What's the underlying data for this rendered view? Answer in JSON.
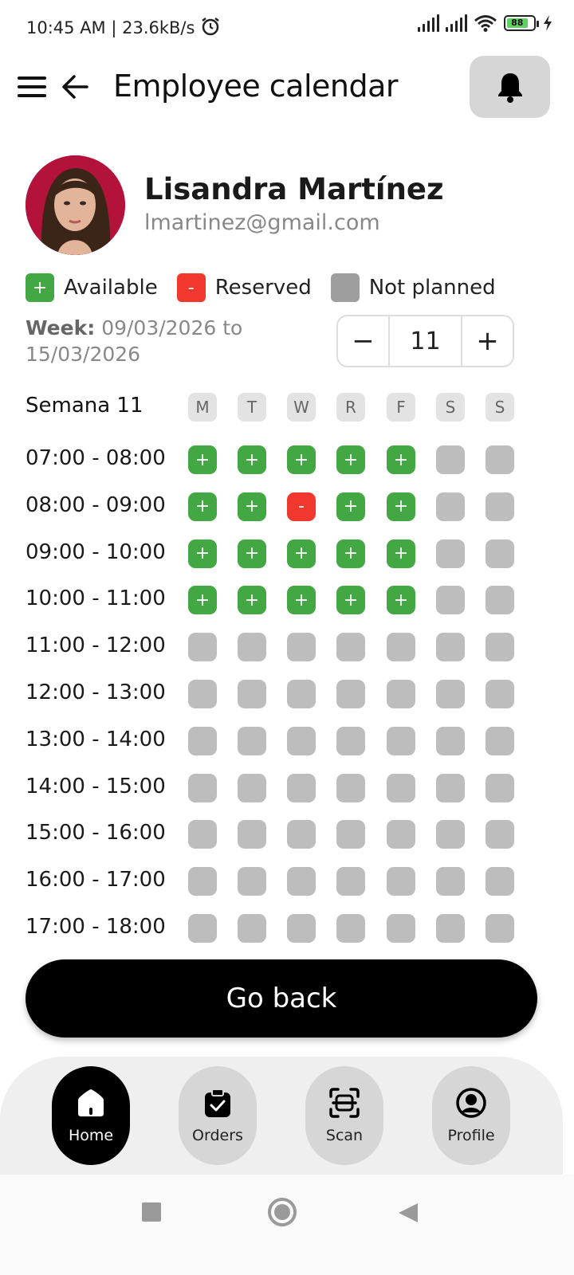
{
  "status_bar": {
    "time": "10:45 AM | 23.6kB/s",
    "battery": "88"
  },
  "header": {
    "title": "Employee calendar"
  },
  "profile": {
    "name": "Lisandra Martínez",
    "email": "lmartinez@gmail.com"
  },
  "legend": [
    {
      "label": "Available",
      "symbol": "+",
      "color": "#43a843"
    },
    {
      "label": "Reserved",
      "symbol": "-",
      "color": "#f0382e"
    },
    {
      "label": "Not planned",
      "symbol": "",
      "color": "#9e9e9e"
    }
  ],
  "week": {
    "label": "Week:",
    "range": "09/03/2026 to 15/03/2026",
    "number": "11"
  },
  "stepper": {
    "minus": "−",
    "plus": "+"
  },
  "calendar": {
    "title": "Semana 11",
    "days": [
      "M",
      "T",
      "W",
      "R",
      "F",
      "S",
      "S"
    ],
    "slots": [
      {
        "time": "07:00 - 08:00",
        "states": [
          "available",
          "available",
          "available",
          "available",
          "available",
          "not_planned",
          "not_planned"
        ]
      },
      {
        "time": "08:00 - 09:00",
        "states": [
          "available",
          "available",
          "reserved",
          "available",
          "available",
          "not_planned",
          "not_planned"
        ]
      },
      {
        "time": "09:00 - 10:00",
        "states": [
          "available",
          "available",
          "available",
          "available",
          "available",
          "not_planned",
          "not_planned"
        ]
      },
      {
        "time": "10:00 - 11:00",
        "states": [
          "available",
          "available",
          "available",
          "available",
          "available",
          "not_planned",
          "not_planned"
        ]
      },
      {
        "time": "11:00 - 12:00",
        "states": [
          "not_planned",
          "not_planned",
          "not_planned",
          "not_planned",
          "not_planned",
          "not_planned",
          "not_planned"
        ]
      },
      {
        "time": "12:00 - 13:00",
        "states": [
          "not_planned",
          "not_planned",
          "not_planned",
          "not_planned",
          "not_planned",
          "not_planned",
          "not_planned"
        ]
      },
      {
        "time": "13:00 - 14:00",
        "states": [
          "not_planned",
          "not_planned",
          "not_planned",
          "not_planned",
          "not_planned",
          "not_planned",
          "not_planned"
        ]
      },
      {
        "time": "14:00 - 15:00",
        "states": [
          "not_planned",
          "not_planned",
          "not_planned",
          "not_planned",
          "not_planned",
          "not_planned",
          "not_planned"
        ]
      },
      {
        "time": "15:00 - 16:00",
        "states": [
          "not_planned",
          "not_planned",
          "not_planned",
          "not_planned",
          "not_planned",
          "not_planned",
          "not_planned"
        ]
      },
      {
        "time": "16:00 - 17:00",
        "states": [
          "not_planned",
          "not_planned",
          "not_planned",
          "not_planned",
          "not_planned",
          "not_planned",
          "not_planned"
        ]
      },
      {
        "time": "17:00 - 18:00",
        "states": [
          "not_planned",
          "not_planned",
          "not_planned",
          "not_planned",
          "not_planned",
          "not_planned",
          "not_planned"
        ]
      }
    ]
  },
  "go_back_label": "Go back",
  "bottom_nav": [
    {
      "label": "Home",
      "icon": "home-icon",
      "active": true
    },
    {
      "label": "Orders",
      "icon": "clipboard-check-icon",
      "active": false
    },
    {
      "label": "Scan",
      "icon": "scan-icon",
      "active": false
    },
    {
      "label": "Profile",
      "icon": "profile-icon",
      "active": false
    }
  ]
}
